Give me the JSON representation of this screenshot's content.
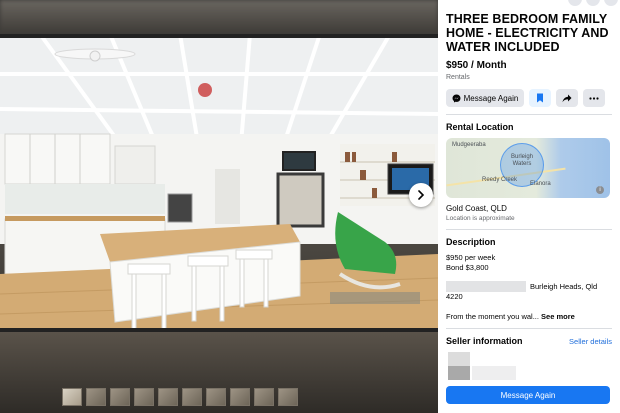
{
  "listing": {
    "title": "THREE BEDROOM FAMILY HOME - ELECTRICITY AND WATER INCLUDED",
    "price": "$950 / Month",
    "category": "Rentals"
  },
  "actions": {
    "message_label": "Message Again",
    "save_icon": "bookmark-icon",
    "share_icon": "share-icon",
    "more_icon": "more-icon"
  },
  "location": {
    "heading": "Rental Location",
    "map_labels": [
      "Mudgeeraba",
      "Burleigh Waters",
      "Reedy Creek",
      "Elanora"
    ],
    "place": "Gold Coast, QLD",
    "note": "Location is approximate"
  },
  "description": {
    "heading": "Description",
    "lines": [
      "$950 per week",
      "Bond $3,800"
    ],
    "address_suffix": "Burleigh Heads, Qld",
    "postcode": "4220",
    "preview": "From the moment you wal...",
    "see_more": "See more"
  },
  "seller": {
    "heading": "Seller information",
    "details_link": "Seller details"
  },
  "footer": {
    "primary_label": "Message Again"
  },
  "colors": {
    "accent": "#1877f2",
    "link": "#216fdb",
    "panel_bg": "#ffffff"
  }
}
